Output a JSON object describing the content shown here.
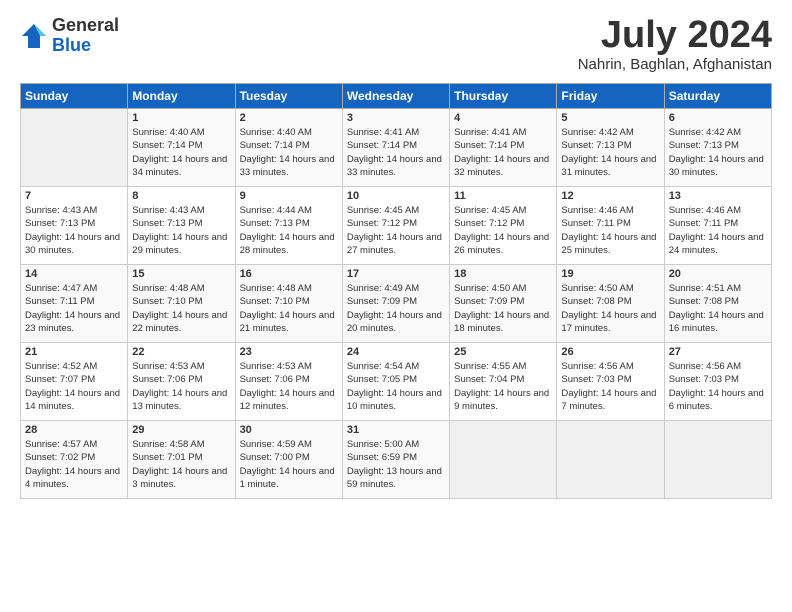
{
  "logo": {
    "general": "General",
    "blue": "Blue"
  },
  "title": {
    "month_year": "July 2024",
    "location": "Nahrin, Baghlan, Afghanistan"
  },
  "weekdays": [
    "Sunday",
    "Monday",
    "Tuesday",
    "Wednesday",
    "Thursday",
    "Friday",
    "Saturday"
  ],
  "weeks": [
    [
      {
        "day": "",
        "sunrise": "",
        "sunset": "",
        "daylight": ""
      },
      {
        "day": "1",
        "sunrise": "Sunrise: 4:40 AM",
        "sunset": "Sunset: 7:14 PM",
        "daylight": "Daylight: 14 hours and 34 minutes."
      },
      {
        "day": "2",
        "sunrise": "Sunrise: 4:40 AM",
        "sunset": "Sunset: 7:14 PM",
        "daylight": "Daylight: 14 hours and 33 minutes."
      },
      {
        "day": "3",
        "sunrise": "Sunrise: 4:41 AM",
        "sunset": "Sunset: 7:14 PM",
        "daylight": "Daylight: 14 hours and 33 minutes."
      },
      {
        "day": "4",
        "sunrise": "Sunrise: 4:41 AM",
        "sunset": "Sunset: 7:14 PM",
        "daylight": "Daylight: 14 hours and 32 minutes."
      },
      {
        "day": "5",
        "sunrise": "Sunrise: 4:42 AM",
        "sunset": "Sunset: 7:13 PM",
        "daylight": "Daylight: 14 hours and 31 minutes."
      },
      {
        "day": "6",
        "sunrise": "Sunrise: 4:42 AM",
        "sunset": "Sunset: 7:13 PM",
        "daylight": "Daylight: 14 hours and 30 minutes."
      }
    ],
    [
      {
        "day": "7",
        "sunrise": "Sunrise: 4:43 AM",
        "sunset": "Sunset: 7:13 PM",
        "daylight": "Daylight: 14 hours and 30 minutes."
      },
      {
        "day": "8",
        "sunrise": "Sunrise: 4:43 AM",
        "sunset": "Sunset: 7:13 PM",
        "daylight": "Daylight: 14 hours and 29 minutes."
      },
      {
        "day": "9",
        "sunrise": "Sunrise: 4:44 AM",
        "sunset": "Sunset: 7:13 PM",
        "daylight": "Daylight: 14 hours and 28 minutes."
      },
      {
        "day": "10",
        "sunrise": "Sunrise: 4:45 AM",
        "sunset": "Sunset: 7:12 PM",
        "daylight": "Daylight: 14 hours and 27 minutes."
      },
      {
        "day": "11",
        "sunrise": "Sunrise: 4:45 AM",
        "sunset": "Sunset: 7:12 PM",
        "daylight": "Daylight: 14 hours and 26 minutes."
      },
      {
        "day": "12",
        "sunrise": "Sunrise: 4:46 AM",
        "sunset": "Sunset: 7:11 PM",
        "daylight": "Daylight: 14 hours and 25 minutes."
      },
      {
        "day": "13",
        "sunrise": "Sunrise: 4:46 AM",
        "sunset": "Sunset: 7:11 PM",
        "daylight": "Daylight: 14 hours and 24 minutes."
      }
    ],
    [
      {
        "day": "14",
        "sunrise": "Sunrise: 4:47 AM",
        "sunset": "Sunset: 7:11 PM",
        "daylight": "Daylight: 14 hours and 23 minutes."
      },
      {
        "day": "15",
        "sunrise": "Sunrise: 4:48 AM",
        "sunset": "Sunset: 7:10 PM",
        "daylight": "Daylight: 14 hours and 22 minutes."
      },
      {
        "day": "16",
        "sunrise": "Sunrise: 4:48 AM",
        "sunset": "Sunset: 7:10 PM",
        "daylight": "Daylight: 14 hours and 21 minutes."
      },
      {
        "day": "17",
        "sunrise": "Sunrise: 4:49 AM",
        "sunset": "Sunset: 7:09 PM",
        "daylight": "Daylight: 14 hours and 20 minutes."
      },
      {
        "day": "18",
        "sunrise": "Sunrise: 4:50 AM",
        "sunset": "Sunset: 7:09 PM",
        "daylight": "Daylight: 14 hours and 18 minutes."
      },
      {
        "day": "19",
        "sunrise": "Sunrise: 4:50 AM",
        "sunset": "Sunset: 7:08 PM",
        "daylight": "Daylight: 14 hours and 17 minutes."
      },
      {
        "day": "20",
        "sunrise": "Sunrise: 4:51 AM",
        "sunset": "Sunset: 7:08 PM",
        "daylight": "Daylight: 14 hours and 16 minutes."
      }
    ],
    [
      {
        "day": "21",
        "sunrise": "Sunrise: 4:52 AM",
        "sunset": "Sunset: 7:07 PM",
        "daylight": "Daylight: 14 hours and 14 minutes."
      },
      {
        "day": "22",
        "sunrise": "Sunrise: 4:53 AM",
        "sunset": "Sunset: 7:06 PM",
        "daylight": "Daylight: 14 hours and 13 minutes."
      },
      {
        "day": "23",
        "sunrise": "Sunrise: 4:53 AM",
        "sunset": "Sunset: 7:06 PM",
        "daylight": "Daylight: 14 hours and 12 minutes."
      },
      {
        "day": "24",
        "sunrise": "Sunrise: 4:54 AM",
        "sunset": "Sunset: 7:05 PM",
        "daylight": "Daylight: 14 hours and 10 minutes."
      },
      {
        "day": "25",
        "sunrise": "Sunrise: 4:55 AM",
        "sunset": "Sunset: 7:04 PM",
        "daylight": "Daylight: 14 hours and 9 minutes."
      },
      {
        "day": "26",
        "sunrise": "Sunrise: 4:56 AM",
        "sunset": "Sunset: 7:03 PM",
        "daylight": "Daylight: 14 hours and 7 minutes."
      },
      {
        "day": "27",
        "sunrise": "Sunrise: 4:56 AM",
        "sunset": "Sunset: 7:03 PM",
        "daylight": "Daylight: 14 hours and 6 minutes."
      }
    ],
    [
      {
        "day": "28",
        "sunrise": "Sunrise: 4:57 AM",
        "sunset": "Sunset: 7:02 PM",
        "daylight": "Daylight: 14 hours and 4 minutes."
      },
      {
        "day": "29",
        "sunrise": "Sunrise: 4:58 AM",
        "sunset": "Sunset: 7:01 PM",
        "daylight": "Daylight: 14 hours and 3 minutes."
      },
      {
        "day": "30",
        "sunrise": "Sunrise: 4:59 AM",
        "sunset": "Sunset: 7:00 PM",
        "daylight": "Daylight: 14 hours and 1 minute."
      },
      {
        "day": "31",
        "sunrise": "Sunrise: 5:00 AM",
        "sunset": "Sunset: 6:59 PM",
        "daylight": "Daylight: 13 hours and 59 minutes."
      },
      {
        "day": "",
        "sunrise": "",
        "sunset": "",
        "daylight": ""
      },
      {
        "day": "",
        "sunrise": "",
        "sunset": "",
        "daylight": ""
      },
      {
        "day": "",
        "sunrise": "",
        "sunset": "",
        "daylight": ""
      }
    ]
  ]
}
